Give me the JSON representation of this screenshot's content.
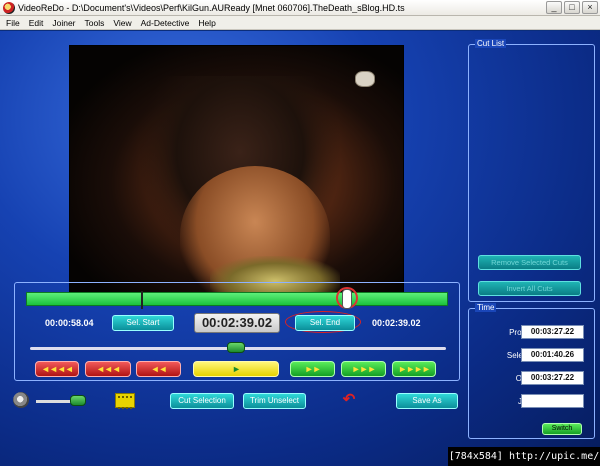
{
  "window": {
    "title": "VideoReDo - D:\\Document's\\Videos\\Perf\\KilGun.AUReady [Mnet 060706].TheDeath_sBlog.HD.ts",
    "min_label": "_",
    "max_label": "□",
    "close_label": "×"
  },
  "menu": [
    "File",
    "Edit",
    "Joiner",
    "Tools",
    "View",
    "Ad-Detective",
    "Help"
  ],
  "cut_list": {
    "title": "Cut List",
    "remove_selected_label": "Remove Selected Cuts",
    "invert_all_label": "Invert All Cuts"
  },
  "controls": {
    "left_time": "00:00:58.04",
    "sel_start_label": "Sel. Start",
    "current_time": "00:02:39.02",
    "sel_end_label": "Sel. End",
    "right_time": "00:02:39.02",
    "nav_buttons": [
      "◄◄◄◄",
      "◄◄◄",
      "◄◄",
      "►",
      "►►",
      "►►►",
      "►►►►"
    ]
  },
  "bottom": {
    "cut_selection_label": "Cut Selection",
    "trim_unselect_label": "Trim Unselect",
    "save_as_label": "Save As"
  },
  "time_panel": {
    "title": "Time",
    "program_label": "Program:",
    "program_value": "00:03:27.22",
    "selection_label": "Selection:",
    "selection_value": "00:01:40.26",
    "output_label": "Output:",
    "output_value": "00:03:27.22",
    "joiner_label": "Joiner:",
    "joiner_value": "",
    "switch_label": "Switch"
  },
  "watermark": "[784x584] http://upic.me/"
}
